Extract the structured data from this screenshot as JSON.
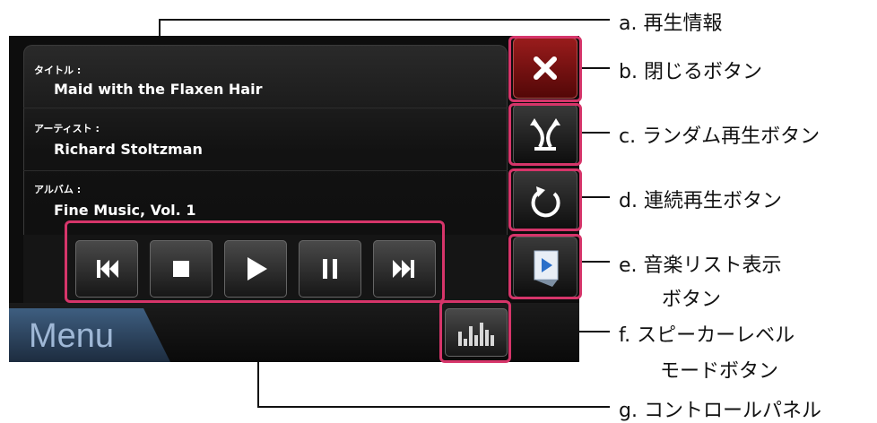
{
  "player": {
    "title_label": "タイトル :",
    "title_value": "Maid with the Flaxen Hair",
    "artist_label": "アーティスト :",
    "artist_value": "Richard Stoltzman",
    "album_label": "アルバム :",
    "album_value": "Fine Music, Vol. 1",
    "menu_label": "Menu"
  },
  "controls": [
    "skip-previous-icon",
    "stop-icon",
    "play-icon",
    "pause-icon",
    "skip-next-icon"
  ],
  "side_buttons": [
    "close-icon",
    "shuffle-icon",
    "repeat-icon",
    "music-list-icon"
  ],
  "callouts": {
    "a": "a.  再生情報",
    "b": "b.  閉じるボタン",
    "c": "c.  ランダム再生ボタン",
    "d": "d.  連続再生ボタン",
    "e1": "e.  音楽リスト表示",
    "e2": "ボタン",
    "f1": "f.  スピーカーレベル",
    "f2": "モードボタン",
    "g": "g.  コントロールパネル"
  },
  "colors": {
    "highlight": "#d6356a",
    "close_button": "#7a1010",
    "menu_tab": "#2f4a6a"
  }
}
